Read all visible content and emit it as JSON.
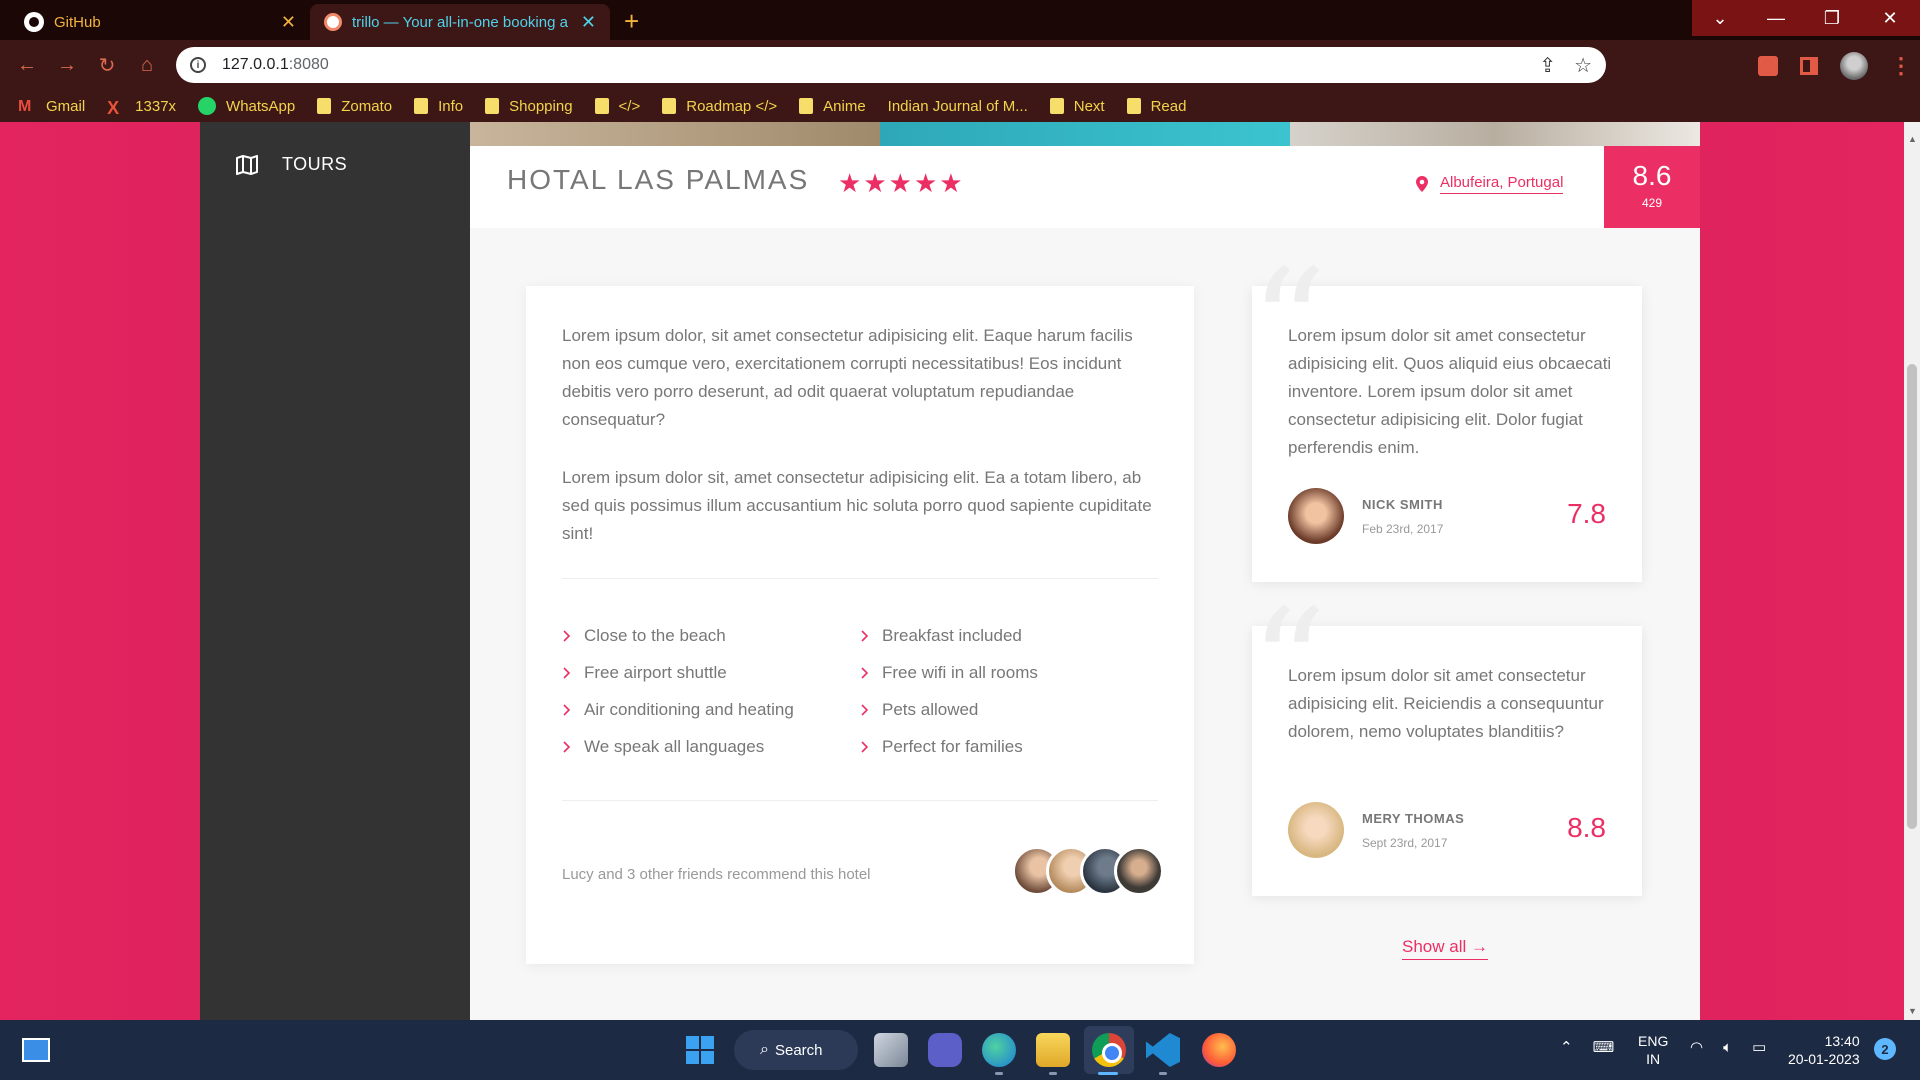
{
  "browser": {
    "tabs": [
      {
        "title": "GitHub",
        "active": false
      },
      {
        "title": "trillo — Your all-in-one booking a",
        "active": true
      }
    ],
    "url_host": "127.0.0.1",
    "url_port": ":8080",
    "bookmarks": [
      {
        "label": "Gmail",
        "icon": "gmail-icon"
      },
      {
        "label": "1337x",
        "icon": "x-icon"
      },
      {
        "label": "WhatsApp",
        "icon": "whatsapp-icon"
      },
      {
        "label": "Zomato",
        "icon": "folder-icon"
      },
      {
        "label": "Info",
        "icon": "folder-icon"
      },
      {
        "label": "Shopping",
        "icon": "folder-icon"
      },
      {
        "label": "</>",
        "icon": "folder-icon"
      },
      {
        "label": "Roadmap </>",
        "icon": "folder-icon"
      },
      {
        "label": "Anime",
        "icon": "folder-icon"
      },
      {
        "label": "Indian Journal of M...",
        "icon": "none"
      },
      {
        "label": "Next",
        "icon": "folder-icon"
      },
      {
        "label": "Read",
        "icon": "folder-icon"
      }
    ]
  },
  "sidebar": {
    "items": [
      {
        "label": "TOURS",
        "icon": "map-icon"
      }
    ]
  },
  "hotel": {
    "name": "HOTAL LAS PALMAS",
    "stars": 5,
    "location": "Albufeira, Portugal",
    "rating_avg": "8.6",
    "rating_count": "429"
  },
  "description": {
    "paragraphs": [
      "Lorem ipsum dolor, sit amet consectetur adipisicing elit. Eaque harum facilis non eos cumque vero, exercitationem corrupti necessitatibus! Eos incidunt debitis vero porro deserunt, ad odit quaerat voluptatum repudiandae consequatur?",
      "Lorem ipsum dolor sit, amet consectetur adipisicing elit. Ea a totam libero, ab sed quis possimus illum accusantium hic soluta porro quod sapiente cupiditate sint!"
    ],
    "features": [
      "Close to the beach",
      "Breakfast included",
      "Free airport shuttle",
      "Free wifi in all rooms",
      "Air conditioning and heating",
      "Pets allowed",
      "We speak all languages",
      "Perfect for families"
    ],
    "recommend_text": "Lucy and 3 other friends recommend this hotel"
  },
  "reviews": [
    {
      "text": "Lorem ipsum dolor sit amet consectetur adipisicing elit. Quos aliquid eius obcaecati inventore. Lorem ipsum dolor sit amet consectetur adipisicing elit. Dolor fugiat perferendis enim.",
      "name": "NICK SMITH",
      "date": "Feb 23rd, 2017",
      "rating": "7.8"
    },
    {
      "text": "Lorem ipsum dolor sit amet consectetur adipisicing elit. Reiciendis a consequuntur dolorem, nemo voluptates blanditiis?",
      "name": "MERY THOMAS",
      "date": "Sept 23rd, 2017",
      "rating": "8.8"
    }
  ],
  "show_all": "Show all →",
  "taskbar": {
    "search_label": "Search",
    "lang_top": "ENG",
    "lang_bottom": "IN",
    "time": "13:40",
    "date": "20-01-2023",
    "notifications": "2"
  },
  "colors": {
    "primary": "#eb2f64",
    "sidebar": "#333333",
    "page_bg": "#f7f7f7"
  }
}
